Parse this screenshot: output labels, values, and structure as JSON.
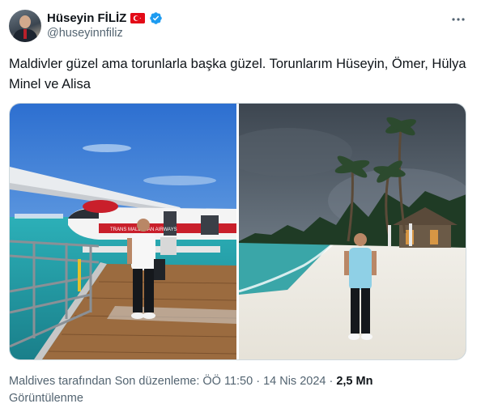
{
  "author": {
    "name": "Hüseyin FİLİZ",
    "handle": "@huseyinnfiliz",
    "flag_icon": "turkey-flag-icon",
    "verified_icon": "verified-badge-icon",
    "verified_color": "#1d9bf0"
  },
  "tweet": {
    "text": "Maldivler güzel ama torunlarla başka güzel. Torunlarım Hüseyin, Ömer, Hülya Minel ve Alisa"
  },
  "media": {
    "photos": [
      {
        "description_icon": "seaplane-dock-photo"
      },
      {
        "description_icon": "beach-palm-photo"
      }
    ],
    "plane_livery_text": "TRANS MALDIVIAN AIRWAYS"
  },
  "footer": {
    "meta": "Maldives tarafından Son düzenleme: ÖÖ 11:50 · 14 Nis 2024 · ",
    "views_count": "2,5 Mn",
    "views_label": "Görüntülenme"
  },
  "colors": {
    "text_primary": "#0f1419",
    "text_secondary": "#536471",
    "flag_red": "#e30a17"
  }
}
